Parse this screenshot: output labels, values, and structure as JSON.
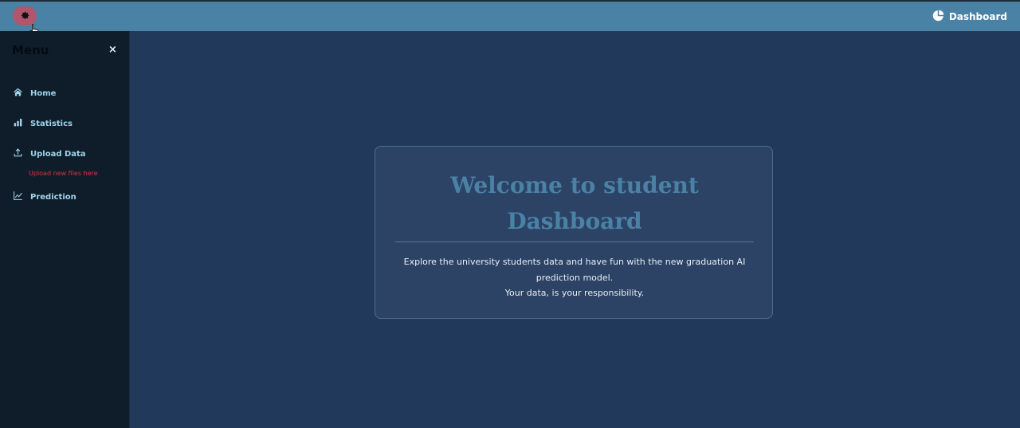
{
  "header": {
    "brand_label": "Dashboard",
    "settings_icon": "gear-icon",
    "brand_icon": "pie-chart-icon",
    "accent_color": "#4a82a6",
    "settings_button_color": "#b2566d"
  },
  "sidebar": {
    "title": "Menu",
    "close_label": "×",
    "items": [
      {
        "label": "Home",
        "icon": "home-icon"
      },
      {
        "label": "Statistics",
        "icon": "bar-chart-icon"
      },
      {
        "label": "Upload Data",
        "icon": "upload-icon"
      },
      {
        "label": "Prediction",
        "icon": "line-chart-icon"
      }
    ],
    "upload_hint": "Upload new files here",
    "hint_color": "#e0303d"
  },
  "main": {
    "welcome_title": "Welcome to student Dashboard",
    "description_line1": "Explore the university students data and have fun with the new graduation AI prediction model.",
    "description_line2": "Your data, is your responsibility."
  }
}
